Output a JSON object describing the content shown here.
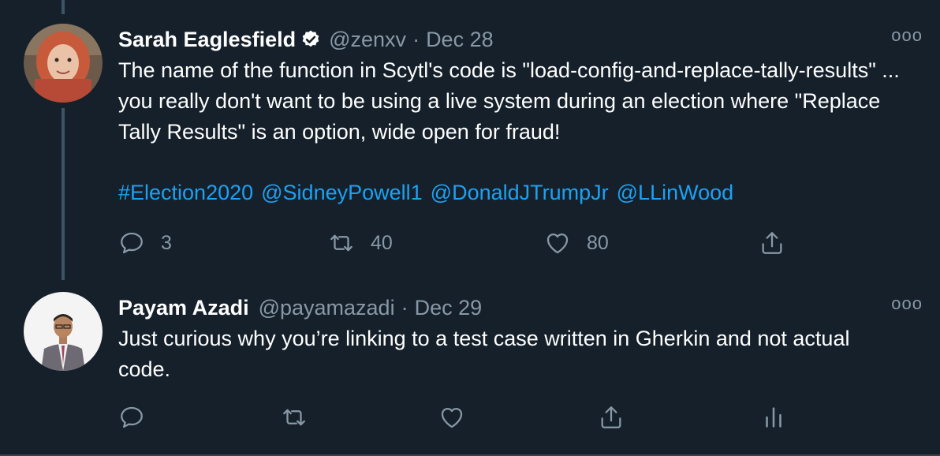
{
  "tweets": [
    {
      "name": "Sarah Eaglesfield",
      "verified": true,
      "handle": "@zenxv",
      "separator": "·",
      "date": "Dec 28",
      "more": "ooo",
      "text": "The name of the function in Scytl's code is \"load-config-and-replace-tally-results\" ... you really don't want to be using a live system during an election where \"Replace Tally Results\" is an option, wide open for fraud!",
      "links": [
        "#Election2020",
        "@SidneyPowell1",
        "@DonaldJTrumpJr",
        "@LLinWood"
      ],
      "replies": "3",
      "retweets": "40",
      "likes": "80"
    },
    {
      "name": "Payam Azadi",
      "verified": false,
      "handle": "@payamazadi",
      "separator": "·",
      "date": "Dec 29",
      "more": "ooo",
      "text": "Just curious why you’re linking to a test case written in Gherkin and not actual code."
    }
  ],
  "colors": {
    "background": "#15202b",
    "secondary_text": "#8899a6",
    "link": "#1da1f2",
    "thread_line": "#3d5466"
  },
  "icons": [
    "reply-icon",
    "retweet-icon",
    "like-icon",
    "share-icon",
    "analytics-icon",
    "verified-badge-icon",
    "more-icon"
  ]
}
